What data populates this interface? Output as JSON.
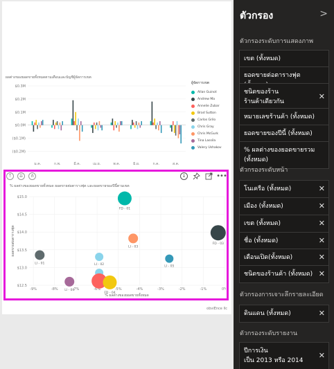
{
  "filter_pane": {
    "title": "ตัวกรอง",
    "collapse_icon": "chevron-right-icon",
    "visual_section": "ตัวกรองระดับการแสดงภาพ",
    "visual_filters": [
      {
        "line1": "เขต (ทั้งหมด)",
        "closable": false
      },
      {
        "line1": "ยอดขายต่อตารางฟุต (ทั้งหมด)",
        "closable": false
      },
      {
        "line1": "ชนิดของร้าน",
        "line2": "ร้านค้าเดียวกัน",
        "closable": true
      },
      {
        "line1": "หมายเลขร้านค้า (ทั้งหมด)",
        "closable": false
      },
      {
        "line1": "ยอดขายของปีนี้ (ทั้งหมด)",
        "closable": false
      },
      {
        "line1": "% ผลต่างของยอดขายรวม (ทั้งหมด)",
        "closable": false
      }
    ],
    "page_section": "ตัวกรองระดับหน้า",
    "page_filters": [
      {
        "line1": "โนเครือ (ทั้งหมด)"
      },
      {
        "line1": "เมือง (ทั้งหมด)"
      },
      {
        "line1": "เขต (ทั้งหมด)"
      },
      {
        "line1": "ชื่อ (ทั้งหมด)"
      },
      {
        "line1": "เดือนเปิด(ทั้งหมด)"
      },
      {
        "line1": "ชนิดของร้านค้า (ทั้งหมด)"
      }
    ],
    "drill_section": "ตัวกรองการเจาะลึกรายละเอียด",
    "drill_filters": [
      {
        "line1": "ดินแดน (ทั้งหมด)"
      }
    ],
    "report_section": "ตัวกรองระดับรายงาน",
    "report_filters": [
      {
        "line1": "ปีการเงิน",
        "line2": "เป็น 2013 หรือ 2014"
      }
    ]
  },
  "top_chart": {
    "title": "ผลต่างของยอดขายทั้งหมดตามเดือนและบัญชีผู้จัดการเขต",
    "legend_title": "ผู้จัดการเขต",
    "legend": [
      {
        "name": "Allan Guinot",
        "color": "#01b8aa"
      },
      {
        "name": "Andrew Ma",
        "color": "#374649"
      },
      {
        "name": "Annelie Zubar",
        "color": "#fd625e"
      },
      {
        "name": "Brad Sutton",
        "color": "#f2c80f"
      },
      {
        "name": "Carlos Grilo",
        "color": "#5f6b6d"
      },
      {
        "name": "Chris Gray",
        "color": "#8ad4eb"
      },
      {
        "name": "Chris McGurk",
        "color": "#fe9666"
      },
      {
        "name": "Tina Lassila",
        "color": "#a66999"
      },
      {
        "name": "Valery Ushakov",
        "color": "#3599b8"
      }
    ]
  },
  "chart_data": [
    {
      "type": "bar",
      "title": "ผลต่างของยอดขายทั้งหมดตามเดือนและบัญชีผู้จัดการเขต",
      "categories": [
        "ม.ค.",
        "ก.พ.",
        "มี.ค.",
        "เม.ย.",
        "พ.ค.",
        "มิ.ย.",
        "ก.ค.",
        "ส.ค."
      ],
      "y_ticks": [
        "$0.3M",
        "$0.2M",
        "$0.1M",
        "$0.0M",
        "($0.1M)",
        "($0.2M)"
      ],
      "ylim": [
        -0.25,
        0.3
      ],
      "legend_title": "ผู้จัดการเขต",
      "series": [
        {
          "name": "Allan Guinot",
          "values": [
            0.03,
            -0.02,
            0.05,
            -0.02,
            0.02,
            -0.03,
            0.03,
            -0.02
          ]
        },
        {
          "name": "Andrew Ma",
          "values": [
            -0.05,
            0.04,
            0.19,
            -0.06,
            0.05,
            0.04,
            0.18,
            -0.05
          ]
        },
        {
          "name": "Annelie Zubar",
          "values": [
            0.02,
            -0.03,
            0.03,
            0.02,
            -0.04,
            0.02,
            0.02,
            0.03
          ]
        },
        {
          "name": "Brad Sutton",
          "values": [
            0.04,
            0.02,
            0.1,
            -0.03,
            0.03,
            -0.02,
            0.05,
            -0.06
          ]
        },
        {
          "name": "Carlos Grilo",
          "values": [
            -0.03,
            0.03,
            -0.04,
            0.02,
            -0.02,
            0.03,
            -0.03,
            -0.08
          ]
        },
        {
          "name": "Chris Gray",
          "values": [
            0.02,
            -0.03,
            0.05,
            -0.04,
            0.02,
            -0.03,
            0.02,
            0.03
          ]
        },
        {
          "name": "Chris McGurk",
          "values": [
            -0.02,
            0.02,
            -0.12,
            0.03,
            -0.05,
            0.02,
            -0.04,
            -0.1
          ]
        },
        {
          "name": "Tina Lassila",
          "values": [
            0.03,
            -0.04,
            0.03,
            -0.02,
            0.03,
            -0.02,
            0.03,
            -0.07
          ]
        },
        {
          "name": "Valery Ushakov",
          "values": [
            0.04,
            0.03,
            -0.05,
            -0.04,
            0.03,
            0.03,
            -0.06,
            -0.14
          ]
        }
      ]
    },
    {
      "type": "scatter",
      "title": "% ผลต่างของยอดขายทั้งหมด ยอดขายต่อตารางฟุต และยอดขายของปีนี้ตามเขต",
      "xlabel": "% ผลต่างของยอดขายทั้งหมด",
      "ylabel": "ยอดขายต่อตารางฟุต",
      "x_ticks": [
        "-9%",
        "-8%",
        "-7%",
        "-6%",
        "-5%",
        "-4%",
        "-3%",
        "-2%",
        "-1%",
        "0%"
      ],
      "y_ticks": [
        "$15.0",
        "$14.5",
        "$14.0",
        "$13.5",
        "$13.0",
        "$12.5"
      ],
      "xlim": [
        -9.2,
        0
      ],
      "ylim": [
        12.5,
        15.0
      ],
      "points": [
        {
          "label": "FD - 01",
          "x": -4.7,
          "y": 14.95,
          "size": 10,
          "color": "#01b8aa"
        },
        {
          "label": "FD - 03",
          "x": -0.3,
          "y": 13.98,
          "size": 11,
          "color": "#374649"
        },
        {
          "label": "LI - 03",
          "x": -4.3,
          "y": 13.82,
          "size": 7,
          "color": "#fe9666"
        },
        {
          "label": "LI - 01",
          "x": -8.7,
          "y": 13.35,
          "size": 7,
          "color": "#5f6b6d"
        },
        {
          "label": "LI - 02",
          "x": -5.9,
          "y": 13.3,
          "size": 6,
          "color": "#8ad4eb"
        },
        {
          "label": "LI - 05",
          "x": -2.6,
          "y": 13.25,
          "size": 6,
          "color": "#3599b8"
        },
        {
          "label": "FD - 02",
          "x": -5.9,
          "y": 12.85,
          "size": 6,
          "color": "#8ad4eb"
        },
        {
          "label": "LI - 04",
          "x": -7.3,
          "y": 12.6,
          "size": 7,
          "color": "#a66999"
        },
        {
          "label": "",
          "x": -5.9,
          "y": 12.62,
          "size": 11,
          "color": "#fd625e"
        },
        {
          "label": "FD - 04",
          "x": -5.4,
          "y": 12.58,
          "size": 10,
          "color": "#f2c80f"
        }
      ]
    }
  ],
  "visual_header": {
    "left_icons": [
      "drill-up-icon",
      "drill-down-all-icon",
      "expand-hierarchy-icon"
    ],
    "right_icons": [
      "drill-down-toggle-icon",
      "pin-icon",
      "focus-mode-icon",
      "more-options-icon"
    ]
  },
  "footer": {
    "logo_text": "obviEnce llc"
  }
}
